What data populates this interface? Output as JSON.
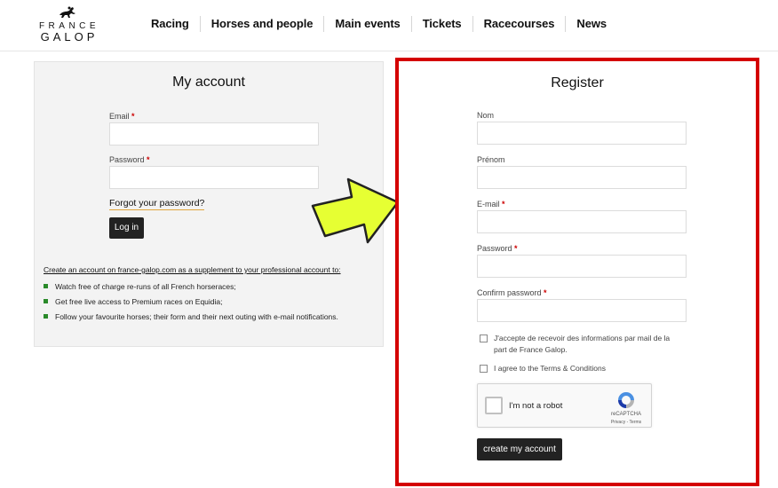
{
  "logo": {
    "line1": "FRANCE",
    "line2": "GALOP"
  },
  "nav": {
    "items": [
      "Racing",
      "Horses and people",
      "Main events",
      "Tickets",
      "Racecourses",
      "News"
    ]
  },
  "login": {
    "title": "My account",
    "email_label": "Email",
    "password_label": "Password",
    "required_mark": "*",
    "forgot_link": "Forgot your password?",
    "login_button": "Log in",
    "create_account_text": "Create an account on france-galop.com as a supplement to your professional account to:",
    "benefits": [
      "Watch free of charge re-runs of all French horseraces;",
      "Get free live access to Premium races on Equidia;",
      "Follow your favourite horses; their form and their next outing with e-mail notifications."
    ]
  },
  "register": {
    "title": "Register",
    "nom_label": "Nom",
    "prenom_label": "Prénom",
    "email_label": "E-mail",
    "password_label": "Password",
    "confirm_label": "Confirm password",
    "required_mark": "*",
    "optin_text": "J'accepte de recevoir des informations par mail de la part de France Galop.",
    "terms_text": "I agree to the Terms & Conditions",
    "recaptcha_label": "I'm not a robot",
    "recaptcha_brand": "reCAPTCHA",
    "recaptcha_links": "Privacy - Terms",
    "submit_button": "create my account"
  },
  "colors": {
    "highlight_border": "#d40000",
    "arrow_fill": "#e6ff33",
    "bullet": "#2a8a2a",
    "button_bg": "#222222"
  }
}
